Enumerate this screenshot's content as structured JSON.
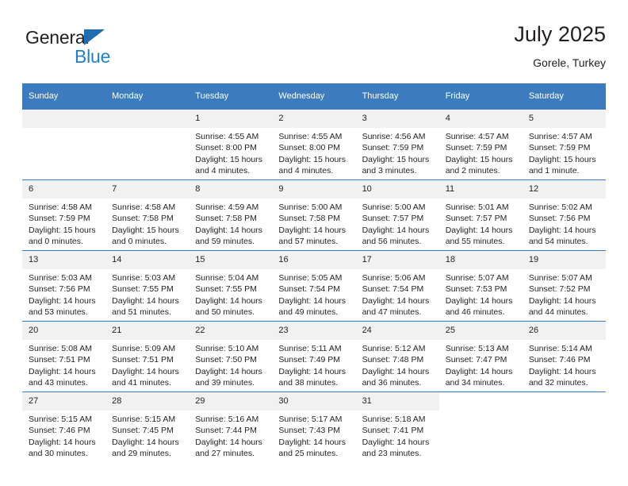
{
  "brand": {
    "name_part1": "General",
    "name_part2": "Blue",
    "accent_color": "#1f7fd0",
    "triangle_color": "#1f6cb0"
  },
  "header": {
    "title": "July 2025",
    "subtitle": "Gorele, Turkey"
  },
  "calendar": {
    "header_color": "#3c7cbe",
    "weekdays": [
      "Sunday",
      "Monday",
      "Tuesday",
      "Wednesday",
      "Thursday",
      "Friday",
      "Saturday"
    ],
    "weeks": [
      [
        {
          "day": "",
          "sunrise": "",
          "sunset": "",
          "daylight": "",
          "empty": true
        },
        {
          "day": "",
          "sunrise": "",
          "sunset": "",
          "daylight": "",
          "empty": true
        },
        {
          "day": "1",
          "sunrise": "Sunrise: 4:55 AM",
          "sunset": "Sunset: 8:00 PM",
          "daylight": "Daylight: 15 hours and 4 minutes."
        },
        {
          "day": "2",
          "sunrise": "Sunrise: 4:55 AM",
          "sunset": "Sunset: 8:00 PM",
          "daylight": "Daylight: 15 hours and 4 minutes."
        },
        {
          "day": "3",
          "sunrise": "Sunrise: 4:56 AM",
          "sunset": "Sunset: 7:59 PM",
          "daylight": "Daylight: 15 hours and 3 minutes."
        },
        {
          "day": "4",
          "sunrise": "Sunrise: 4:57 AM",
          "sunset": "Sunset: 7:59 PM",
          "daylight": "Daylight: 15 hours and 2 minutes."
        },
        {
          "day": "5",
          "sunrise": "Sunrise: 4:57 AM",
          "sunset": "Sunset: 7:59 PM",
          "daylight": "Daylight: 15 hours and 1 minute."
        }
      ],
      [
        {
          "day": "6",
          "sunrise": "Sunrise: 4:58 AM",
          "sunset": "Sunset: 7:59 PM",
          "daylight": "Daylight: 15 hours and 0 minutes."
        },
        {
          "day": "7",
          "sunrise": "Sunrise: 4:58 AM",
          "sunset": "Sunset: 7:58 PM",
          "daylight": "Daylight: 15 hours and 0 minutes."
        },
        {
          "day": "8",
          "sunrise": "Sunrise: 4:59 AM",
          "sunset": "Sunset: 7:58 PM",
          "daylight": "Daylight: 14 hours and 59 minutes."
        },
        {
          "day": "9",
          "sunrise": "Sunrise: 5:00 AM",
          "sunset": "Sunset: 7:58 PM",
          "daylight": "Daylight: 14 hours and 57 minutes."
        },
        {
          "day": "10",
          "sunrise": "Sunrise: 5:00 AM",
          "sunset": "Sunset: 7:57 PM",
          "daylight": "Daylight: 14 hours and 56 minutes."
        },
        {
          "day": "11",
          "sunrise": "Sunrise: 5:01 AM",
          "sunset": "Sunset: 7:57 PM",
          "daylight": "Daylight: 14 hours and 55 minutes."
        },
        {
          "day": "12",
          "sunrise": "Sunrise: 5:02 AM",
          "sunset": "Sunset: 7:56 PM",
          "daylight": "Daylight: 14 hours and 54 minutes."
        }
      ],
      [
        {
          "day": "13",
          "sunrise": "Sunrise: 5:03 AM",
          "sunset": "Sunset: 7:56 PM",
          "daylight": "Daylight: 14 hours and 53 minutes."
        },
        {
          "day": "14",
          "sunrise": "Sunrise: 5:03 AM",
          "sunset": "Sunset: 7:55 PM",
          "daylight": "Daylight: 14 hours and 51 minutes."
        },
        {
          "day": "15",
          "sunrise": "Sunrise: 5:04 AM",
          "sunset": "Sunset: 7:55 PM",
          "daylight": "Daylight: 14 hours and 50 minutes."
        },
        {
          "day": "16",
          "sunrise": "Sunrise: 5:05 AM",
          "sunset": "Sunset: 7:54 PM",
          "daylight": "Daylight: 14 hours and 49 minutes."
        },
        {
          "day": "17",
          "sunrise": "Sunrise: 5:06 AM",
          "sunset": "Sunset: 7:54 PM",
          "daylight": "Daylight: 14 hours and 47 minutes."
        },
        {
          "day": "18",
          "sunrise": "Sunrise: 5:07 AM",
          "sunset": "Sunset: 7:53 PM",
          "daylight": "Daylight: 14 hours and 46 minutes."
        },
        {
          "day": "19",
          "sunrise": "Sunrise: 5:07 AM",
          "sunset": "Sunset: 7:52 PM",
          "daylight": "Daylight: 14 hours and 44 minutes."
        }
      ],
      [
        {
          "day": "20",
          "sunrise": "Sunrise: 5:08 AM",
          "sunset": "Sunset: 7:51 PM",
          "daylight": "Daylight: 14 hours and 43 minutes."
        },
        {
          "day": "21",
          "sunrise": "Sunrise: 5:09 AM",
          "sunset": "Sunset: 7:51 PM",
          "daylight": "Daylight: 14 hours and 41 minutes."
        },
        {
          "day": "22",
          "sunrise": "Sunrise: 5:10 AM",
          "sunset": "Sunset: 7:50 PM",
          "daylight": "Daylight: 14 hours and 39 minutes."
        },
        {
          "day": "23",
          "sunrise": "Sunrise: 5:11 AM",
          "sunset": "Sunset: 7:49 PM",
          "daylight": "Daylight: 14 hours and 38 minutes."
        },
        {
          "day": "24",
          "sunrise": "Sunrise: 5:12 AM",
          "sunset": "Sunset: 7:48 PM",
          "daylight": "Daylight: 14 hours and 36 minutes."
        },
        {
          "day": "25",
          "sunrise": "Sunrise: 5:13 AM",
          "sunset": "Sunset: 7:47 PM",
          "daylight": "Daylight: 14 hours and 34 minutes."
        },
        {
          "day": "26",
          "sunrise": "Sunrise: 5:14 AM",
          "sunset": "Sunset: 7:46 PM",
          "daylight": "Daylight: 14 hours and 32 minutes."
        }
      ],
      [
        {
          "day": "27",
          "sunrise": "Sunrise: 5:15 AM",
          "sunset": "Sunset: 7:46 PM",
          "daylight": "Daylight: 14 hours and 30 minutes."
        },
        {
          "day": "28",
          "sunrise": "Sunrise: 5:15 AM",
          "sunset": "Sunset: 7:45 PM",
          "daylight": "Daylight: 14 hours and 29 minutes."
        },
        {
          "day": "29",
          "sunrise": "Sunrise: 5:16 AM",
          "sunset": "Sunset: 7:44 PM",
          "daylight": "Daylight: 14 hours and 27 minutes."
        },
        {
          "day": "30",
          "sunrise": "Sunrise: 5:17 AM",
          "sunset": "Sunset: 7:43 PM",
          "daylight": "Daylight: 14 hours and 25 minutes."
        },
        {
          "day": "31",
          "sunrise": "Sunrise: 5:18 AM",
          "sunset": "Sunset: 7:41 PM",
          "daylight": "Daylight: 14 hours and 23 minutes."
        },
        {
          "day": "",
          "sunrise": "",
          "sunset": "",
          "daylight": "",
          "blank": true
        },
        {
          "day": "",
          "sunrise": "",
          "sunset": "",
          "daylight": "",
          "blank": true
        }
      ]
    ]
  }
}
